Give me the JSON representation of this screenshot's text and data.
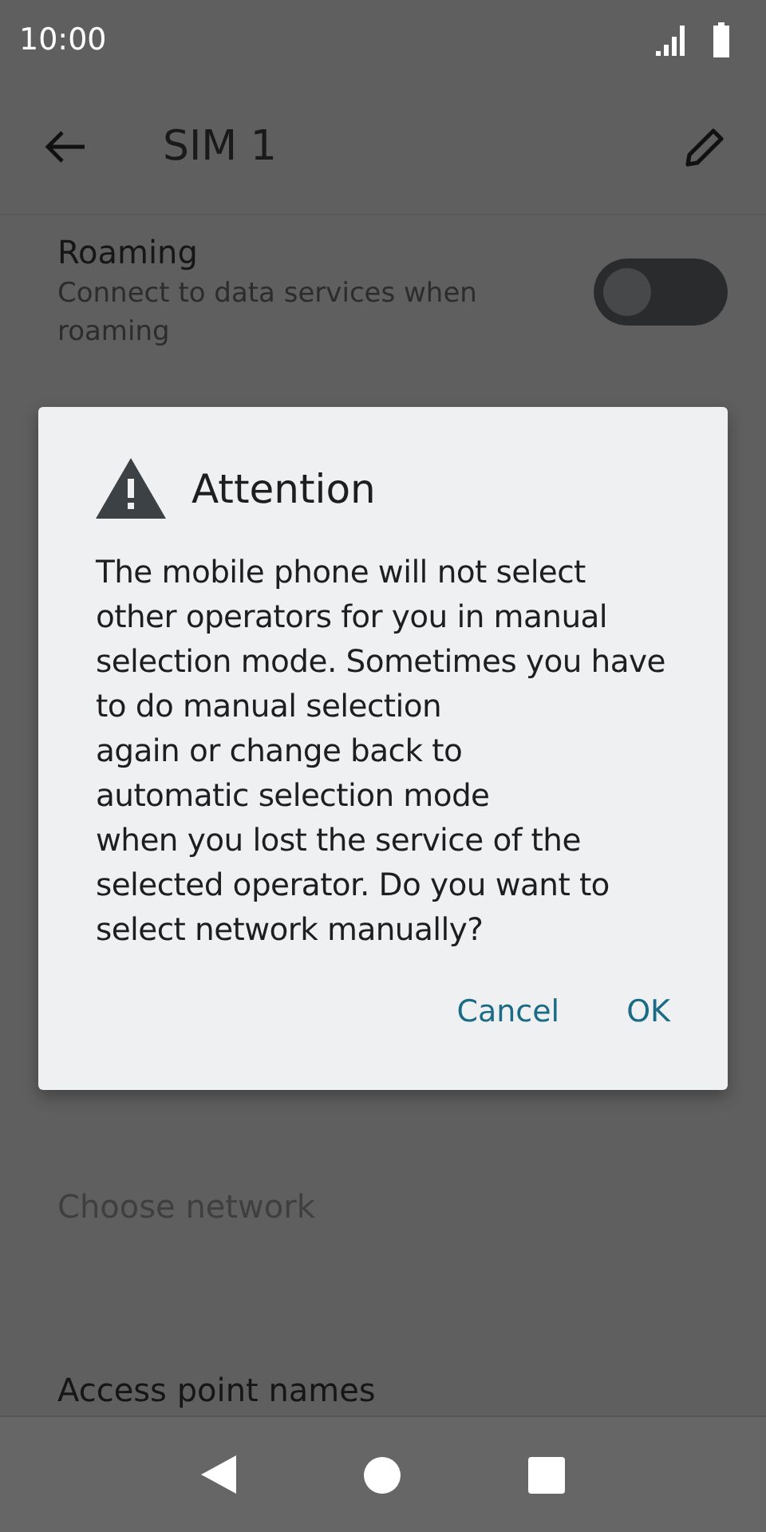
{
  "status_bar": {
    "time": "10:00"
  },
  "app_bar": {
    "title": "SIM 1"
  },
  "settings": [
    {
      "kind": "toggle",
      "title": "Roaming",
      "summary": "Connect to data services when roaming",
      "on": false,
      "disabled": false
    },
    {
      "kind": "plain",
      "title": "Choose network",
      "disabled": true
    },
    {
      "kind": "plain",
      "title": "Access point names",
      "disabled": false
    }
  ],
  "dialog": {
    "title": "Attention",
    "message": "The mobile phone will not select other operators for you in manual selection mode. Sometimes you have to do manual selection\nagain or change back to\nautomatic selection mode\nwhen you lost the service of the selected operator. Do you want to select network manually?",
    "buttons": [
      "Cancel",
      "OK"
    ]
  }
}
